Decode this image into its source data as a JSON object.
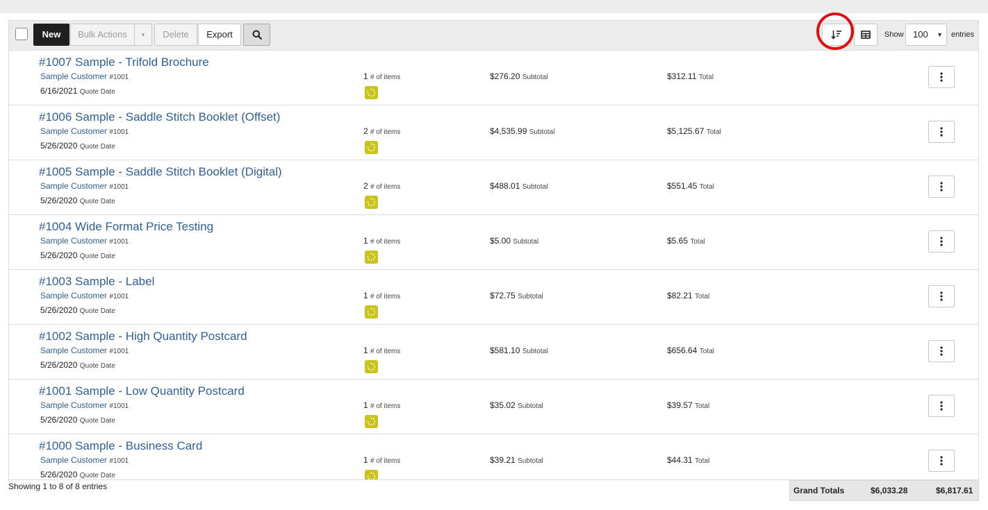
{
  "toolbar": {
    "new_label": "New",
    "bulk_label": "Bulk Actions",
    "bulk_caret": "▾",
    "delete_label": "Delete",
    "export_label": "Export",
    "search_icon": "search-icon",
    "sort_icon": "sort-icon",
    "grid_icon": "table-view-icon",
    "show_label": "Show",
    "show_value": "100",
    "entries_label": "entries"
  },
  "labels": {
    "customer_number": "#1001",
    "quote_date": "Quote Date",
    "num_items": "# of items",
    "subtotal": "Subtotal",
    "total": "Total"
  },
  "quotes": [
    {
      "title": "#1007 Sample - Trifold Brochure",
      "customer": "Sample Customer",
      "date": "6/16/2021",
      "items": "1",
      "subtotal": "$276.20",
      "total": "$312.11"
    },
    {
      "title": "#1006 Sample - Saddle Stitch Booklet (Offset)",
      "customer": "Sample Customer",
      "date": "5/26/2020",
      "items": "2",
      "subtotal": "$4,535.99",
      "total": "$5,125.67"
    },
    {
      "title": "#1005 Sample - Saddle Stitch Booklet (Digital)",
      "customer": "Sample Customer",
      "date": "5/26/2020",
      "items": "2",
      "subtotal": "$488.01",
      "total": "$551.45"
    },
    {
      "title": "#1004 Wide Format Price Testing",
      "customer": "Sample Customer",
      "date": "5/26/2020",
      "items": "1",
      "subtotal": "$5.00",
      "total": "$5.65"
    },
    {
      "title": "#1003 Sample - Label",
      "customer": "Sample Customer",
      "date": "5/26/2020",
      "items": "1",
      "subtotal": "$72.75",
      "total": "$82.21"
    },
    {
      "title": "#1002 Sample - High Quantity Postcard",
      "customer": "Sample Customer",
      "date": "5/26/2020",
      "items": "1",
      "subtotal": "$581.10",
      "total": "$656.64"
    },
    {
      "title": "#1001 Sample - Low Quantity Postcard",
      "customer": "Sample Customer",
      "date": "5/26/2020",
      "items": "1",
      "subtotal": "$35.02",
      "total": "$39.57"
    },
    {
      "title": "#1000 Sample - Business Card",
      "customer": "Sample Customer",
      "date": "5/26/2020",
      "items": "1",
      "subtotal": "$39.21",
      "total": "$44.31"
    }
  ],
  "footer": {
    "showing": "Showing 1 to 8 of 8 entries",
    "grand_label": "Grand Totals",
    "grand_subtotal": "$6,033.28",
    "grand_total": "$6,817.61"
  },
  "colors": {
    "link": "#2f5f9a",
    "status": "#c9c31a",
    "highlight": "#e01010"
  }
}
